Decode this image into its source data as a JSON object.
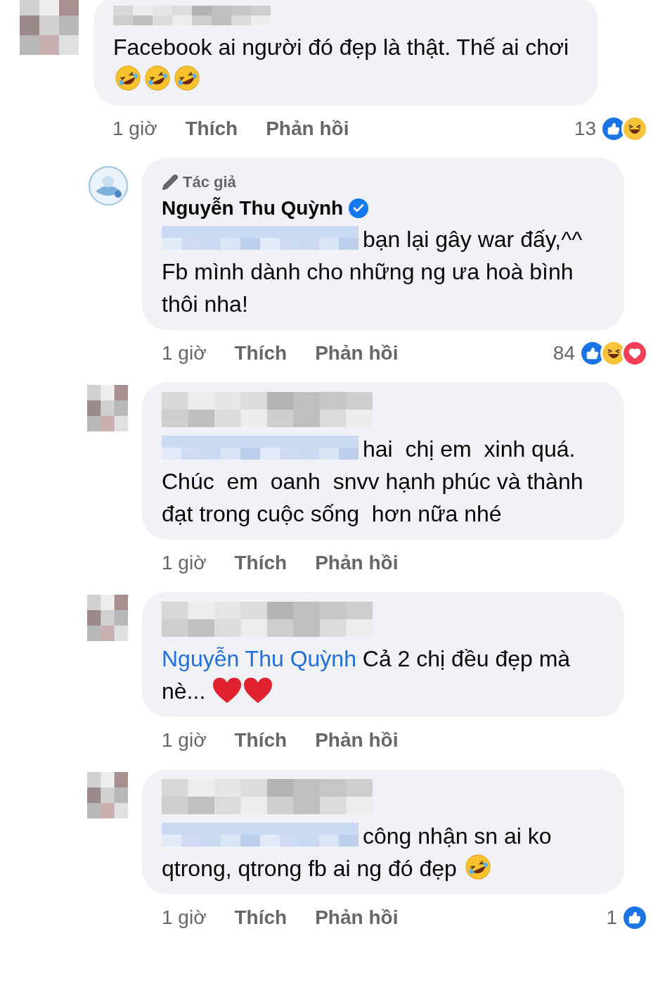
{
  "comments": [
    {
      "author_hidden": true,
      "body": [
        {
          "kind": "text",
          "text": "Facebook ai người đó đẹp là thật. Thế ai chơi "
        },
        {
          "kind": "rofl"
        },
        {
          "kind": "rofl"
        },
        {
          "kind": "rofl"
        }
      ],
      "time": "1 giờ",
      "like": "Thích",
      "reply": "Phản hồi",
      "reaction_count": "13",
      "reactions": [
        {
          "kind": "like"
        },
        {
          "kind": "haha"
        }
      ],
      "children": [
        {
          "author_hidden": false,
          "author_badge": "Tác giả",
          "author": "Nguyễn Thu Quỳnh",
          "verified": true,
          "body": [
            {
              "kind": "blur"
            },
            {
              "kind": "text",
              "text": "bạn lại gây war đấy,^^ Fb mình dành cho những ng ưa hoà bình thôi nha!"
            }
          ],
          "time": "1 giờ",
          "like": "Thích",
          "reply": "Phản hồi",
          "reaction_count": "84",
          "reactions": [
            {
              "kind": "like"
            },
            {
              "kind": "haha"
            },
            {
              "kind": "love"
            }
          ]
        },
        {
          "author_hidden": true,
          "body": [
            {
              "kind": "blur"
            },
            {
              "kind": "text",
              "text": "hai  chị em  xinh quá.  Chúc  em  oanh  snvv hạnh phúc và thành đạt trong cuộc sống  hơn nữa nhé"
            }
          ],
          "time": "1 giờ",
          "like": "Thích",
          "reply": "Phản hồi"
        },
        {
          "author_hidden": true,
          "body": [
            {
              "kind": "mention",
              "text": "Nguyễn Thu Quỳnh"
            },
            {
              "kind": "text",
              "text": " Cả 2 chị đều đẹp mà nè... "
            },
            {
              "kind": "heart"
            },
            {
              "kind": "heart"
            }
          ],
          "time": "1 giờ",
          "like": "Thích",
          "reply": "Phản hồi"
        },
        {
          "author_hidden": true,
          "body": [
            {
              "kind": "blur"
            },
            {
              "kind": "text",
              "text": "công nhận sn ai ko qtrong, qtrong fb ai ng đó đẹp "
            },
            {
              "kind": "rofl"
            }
          ],
          "time": "1 giờ",
          "like": "Thích",
          "reply": "Phản hồi",
          "reaction_count": "1",
          "reactions": [
            {
              "kind": "like"
            }
          ]
        }
      ]
    }
  ]
}
